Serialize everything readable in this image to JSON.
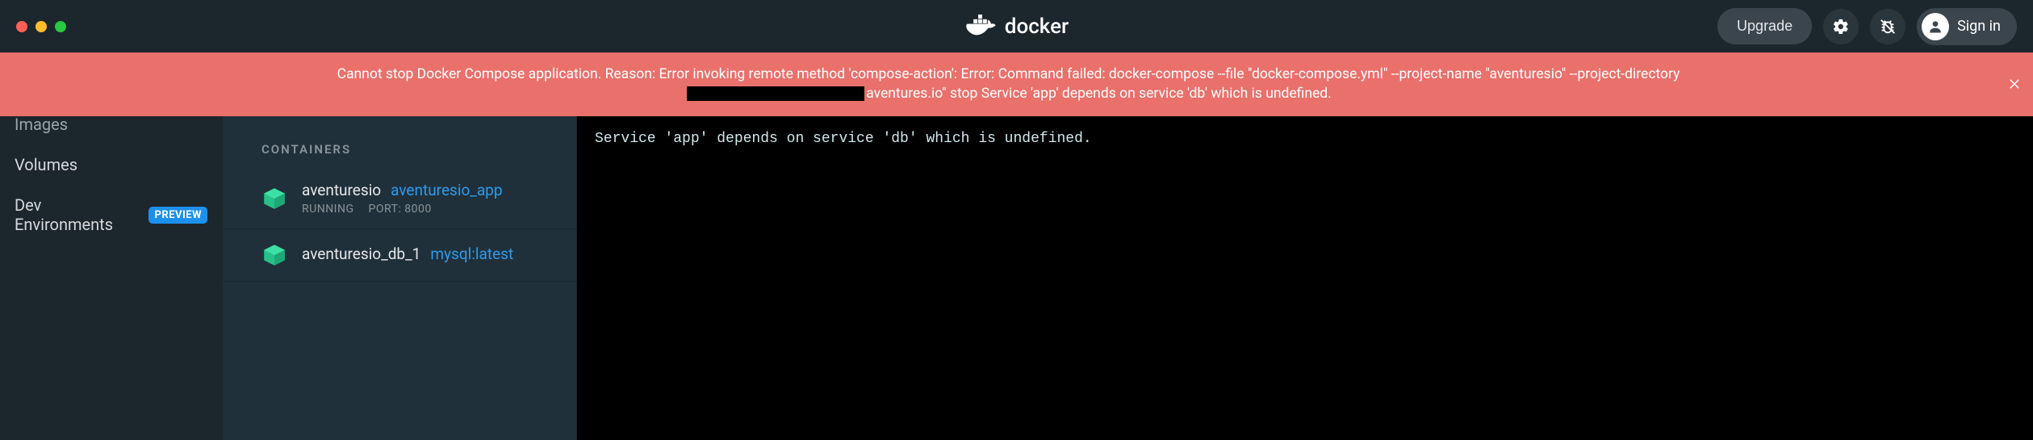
{
  "header": {
    "brand": "docker",
    "upgrade_label": "Upgrade",
    "signin_label": "Sign in"
  },
  "error": {
    "part1": "Cannot stop Docker Compose application. Reason: Error invoking remote method 'compose-action': Error: Command failed: docker-compose --file \"docker-compose.yml\" --project-name \"aventuresio\" --project-directory",
    "part2": "aventures.io\" stop Service 'app' depends on service 'db' which is undefined."
  },
  "sidebar": {
    "items": [
      {
        "label": "Images"
      },
      {
        "label": "Volumes"
      },
      {
        "label": "Dev Environments",
        "badge": "PREVIEW"
      }
    ]
  },
  "containers": {
    "section_label": "CONTAINERS",
    "list": [
      {
        "name": "aventuresio",
        "image": "aventuresio_app",
        "status": "RUNNING",
        "port_label": "PORT: 8000"
      },
      {
        "name": "aventuresio_db_1",
        "image": "mysql:latest",
        "status": "",
        "port_label": ""
      }
    ]
  },
  "log": {
    "line1": "Service 'app' depends on service 'db' which is undefined."
  },
  "colors": {
    "error_bg": "#e9706b",
    "accent": "#1c90ed",
    "running": "#2ecc71"
  }
}
